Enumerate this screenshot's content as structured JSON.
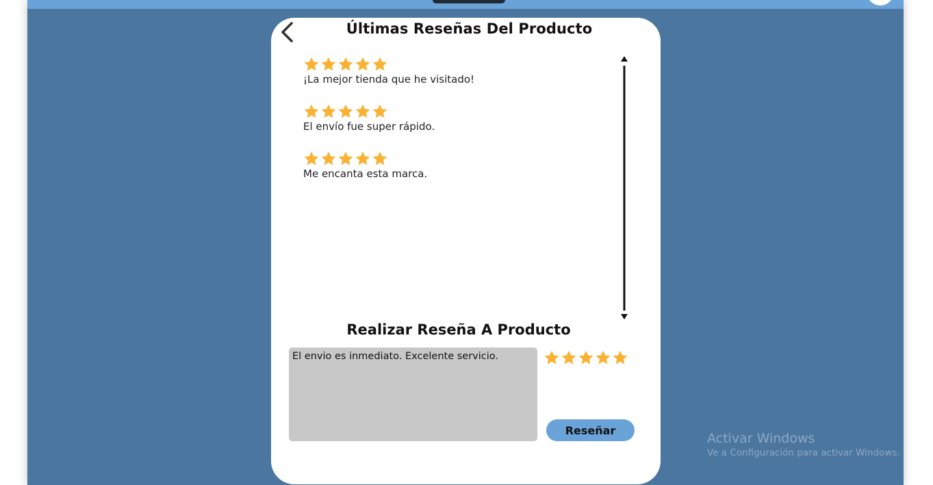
{
  "colors": {
    "app_background": "#4a76a0",
    "top_bar": "#6aa3d8",
    "card": "#ffffff",
    "star": "#f9b233",
    "input_background": "#c8c8c8",
    "button": "#6aa3d8"
  },
  "header": {
    "back_icon": "chevron-left-icon",
    "title": "Últimas Reseñas Del Producto"
  },
  "reviews": [
    {
      "rating": 5,
      "text": "¡La mejor tienda que he visitado!"
    },
    {
      "rating": 5,
      "text": "El envío fue super rápido."
    },
    {
      "rating": 5,
      "text": "Me encanta esta marca."
    }
  ],
  "compose": {
    "title": "Realizar Reseña A Producto",
    "review_value": "El envio es inmediato. Excelente servicio.",
    "rating": 5,
    "submit_label": "Reseñar"
  },
  "watermark": {
    "title": "Activar Windows",
    "subtitle": "Ve a Configuración para activar Windows."
  }
}
